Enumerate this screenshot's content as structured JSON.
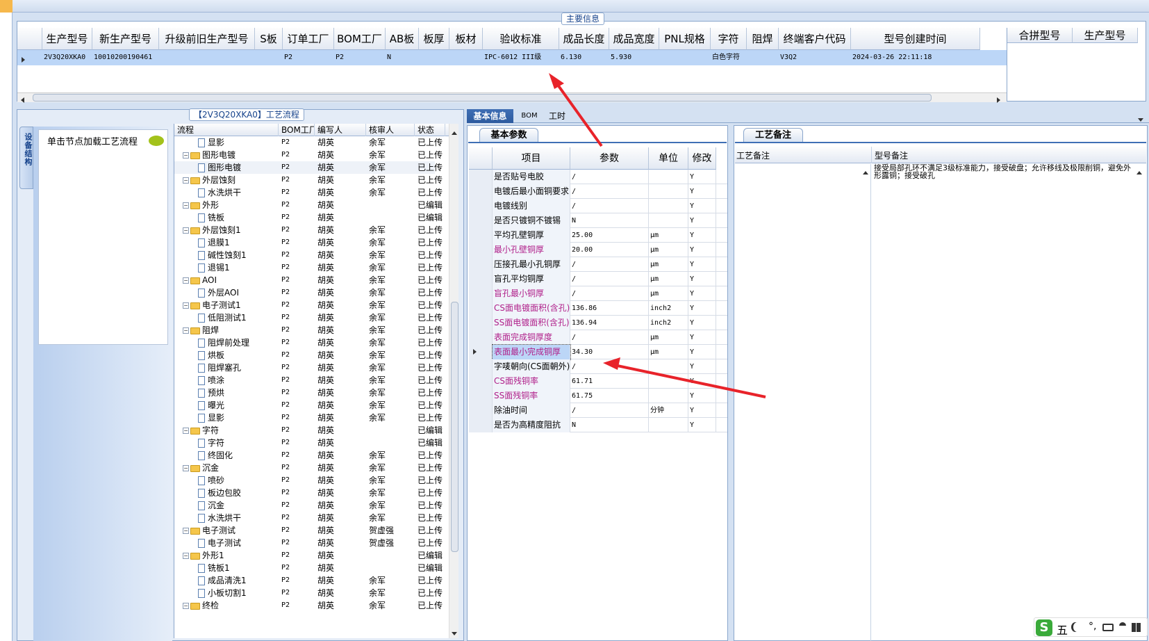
{
  "main_info": {
    "title": "主要信息",
    "columns": [
      "生产型号",
      "新生产型号",
      "升级前旧生产型号",
      "S板",
      "订单工厂",
      "BOM工厂",
      "AB板",
      "板厚",
      "板材",
      "验收标准",
      "成品长度",
      "成品宽度",
      "PNL规格",
      "字符",
      "阻焊",
      "终端客户代码",
      "型号创建时间"
    ],
    "row": [
      "2V3Q20XKA0",
      "10010200190461",
      "",
      "",
      "P2",
      "P2",
      "N",
      "",
      "",
      "IPC-6012 III级",
      "6.130",
      "5.930",
      "",
      "白色字符",
      "",
      "V3Q2",
      "2024-03-26 22:11:18"
    ],
    "side_columns": [
      "合拼型号",
      "生产型号"
    ]
  },
  "process": {
    "title": "【2V3Q20XKA0】工艺流程",
    "vertical_tab": "设备结构",
    "load_button": "单击节点加载工艺流程",
    "columns": [
      "流程",
      "BOM工厂",
      "编写人",
      "核审人",
      "状态"
    ],
    "rows": [
      {
        "level": 2,
        "name": "显影",
        "bom": "P2",
        "writer": "胡英",
        "checker": "余军",
        "status": "已上传"
      },
      {
        "level": 1,
        "name": "图形电镀",
        "bom": "P2",
        "writer": "胡英",
        "checker": "余军",
        "status": "已上传"
      },
      {
        "level": 2,
        "name": "图形电镀",
        "bom": "P2",
        "writer": "胡英",
        "checker": "余军",
        "status": "已上传"
      },
      {
        "level": 1,
        "name": "外层蚀刻",
        "bom": "P2",
        "writer": "胡英",
        "checker": "余军",
        "status": "已上传"
      },
      {
        "level": 2,
        "name": "水洗烘干",
        "bom": "P2",
        "writer": "胡英",
        "checker": "余军",
        "status": "已上传"
      },
      {
        "level": 1,
        "name": "外形",
        "bom": "P2",
        "writer": "胡英",
        "checker": "",
        "status": "已编辑"
      },
      {
        "level": 2,
        "name": "铣板",
        "bom": "P2",
        "writer": "胡英",
        "checker": "",
        "status": "已编辑"
      },
      {
        "level": 1,
        "name": "外层蚀刻1",
        "bom": "P2",
        "writer": "胡英",
        "checker": "余军",
        "status": "已上传"
      },
      {
        "level": 2,
        "name": "退膜1",
        "bom": "P2",
        "writer": "胡英",
        "checker": "余军",
        "status": "已上传"
      },
      {
        "level": 2,
        "name": "碱性蚀刻1",
        "bom": "P2",
        "writer": "胡英",
        "checker": "余军",
        "status": "已上传"
      },
      {
        "level": 2,
        "name": "退锡1",
        "bom": "P2",
        "writer": "胡英",
        "checker": "余军",
        "status": "已上传"
      },
      {
        "level": 1,
        "name": "AOI",
        "bom": "P2",
        "writer": "胡英",
        "checker": "余军",
        "status": "已上传"
      },
      {
        "level": 2,
        "name": "外层AOI",
        "bom": "P2",
        "writer": "胡英",
        "checker": "余军",
        "status": "已上传"
      },
      {
        "level": 1,
        "name": "电子测试1",
        "bom": "P2",
        "writer": "胡英",
        "checker": "余军",
        "status": "已上传"
      },
      {
        "level": 2,
        "name": "低阻测试1",
        "bom": "P2",
        "writer": "胡英",
        "checker": "余军",
        "status": "已上传"
      },
      {
        "level": 1,
        "name": "阻焊",
        "bom": "P2",
        "writer": "胡英",
        "checker": "余军",
        "status": "已上传"
      },
      {
        "level": 2,
        "name": "阻焊前处理",
        "bom": "P2",
        "writer": "胡英",
        "checker": "余军",
        "status": "已上传"
      },
      {
        "level": 2,
        "name": "烘板",
        "bom": "P2",
        "writer": "胡英",
        "checker": "余军",
        "status": "已上传"
      },
      {
        "level": 2,
        "name": "阻焊塞孔",
        "bom": "P2",
        "writer": "胡英",
        "checker": "余军",
        "status": "已上传"
      },
      {
        "level": 2,
        "name": "喷涂",
        "bom": "P2",
        "writer": "胡英",
        "checker": "余军",
        "status": "已上传"
      },
      {
        "level": 2,
        "name": "预烘",
        "bom": "P2",
        "writer": "胡英",
        "checker": "余军",
        "status": "已上传"
      },
      {
        "level": 2,
        "name": "曝光",
        "bom": "P2",
        "writer": "胡英",
        "checker": "余军",
        "status": "已上传"
      },
      {
        "level": 2,
        "name": "显影",
        "bom": "P2",
        "writer": "胡英",
        "checker": "余军",
        "status": "已上传"
      },
      {
        "level": 1,
        "name": "字符",
        "bom": "P2",
        "writer": "胡英",
        "checker": "",
        "status": "已编辑"
      },
      {
        "level": 2,
        "name": "字符",
        "bom": "P2",
        "writer": "胡英",
        "checker": "",
        "status": "已编辑"
      },
      {
        "level": 2,
        "name": "终固化",
        "bom": "P2",
        "writer": "胡英",
        "checker": "余军",
        "status": "已上传"
      },
      {
        "level": 1,
        "name": "沉金",
        "bom": "P2",
        "writer": "胡英",
        "checker": "余军",
        "status": "已上传"
      },
      {
        "level": 2,
        "name": "喷砂",
        "bom": "P2",
        "writer": "胡英",
        "checker": "余军",
        "status": "已上传"
      },
      {
        "level": 2,
        "name": "板边包胶",
        "bom": "P2",
        "writer": "胡英",
        "checker": "余军",
        "status": "已上传"
      },
      {
        "level": 2,
        "name": "沉金",
        "bom": "P2",
        "writer": "胡英",
        "checker": "余军",
        "status": "已上传"
      },
      {
        "level": 2,
        "name": "水洗烘干",
        "bom": "P2",
        "writer": "胡英",
        "checker": "余军",
        "status": "已上传"
      },
      {
        "level": 1,
        "name": "电子测试",
        "bom": "P2",
        "writer": "胡英",
        "checker": "贺虚强",
        "status": "已上传"
      },
      {
        "level": 2,
        "name": "电子测试",
        "bom": "P2",
        "writer": "胡英",
        "checker": "贺虚强",
        "status": "已上传"
      },
      {
        "level": 1,
        "name": "外形1",
        "bom": "P2",
        "writer": "胡英",
        "checker": "",
        "status": "已编辑"
      },
      {
        "level": 2,
        "name": "铣板1",
        "bom": "P2",
        "writer": "胡英",
        "checker": "",
        "status": "已编辑"
      },
      {
        "level": 2,
        "name": "成品清洗1",
        "bom": "P2",
        "writer": "胡英",
        "checker": "余军",
        "status": "已上传"
      },
      {
        "level": 2,
        "name": "小板切割1",
        "bom": "P2",
        "writer": "胡英",
        "checker": "余军",
        "status": "已上传"
      },
      {
        "level": 1,
        "name": "终检",
        "bom": "P2",
        "writer": "胡英",
        "checker": "余军",
        "status": "已上传"
      }
    ]
  },
  "tabs": [
    "基本信息",
    "BOM",
    "工时"
  ],
  "params": {
    "subtab": "基本参数",
    "columns": [
      "项目",
      "参数",
      "单位",
      "修改"
    ],
    "rows": [
      {
        "item": "是否贴号电胶",
        "value": "/",
        "unit": "",
        "mod": "Y",
        "color": "#000000"
      },
      {
        "item": "电镀后最小面铜要求",
        "value": "/",
        "unit": "",
        "mod": "Y",
        "color": "#000000"
      },
      {
        "item": "电镀线别",
        "value": "/",
        "unit": "",
        "mod": "Y",
        "color": "#000000"
      },
      {
        "item": "是否只镀铜不镀锡",
        "value": "N",
        "unit": "",
        "mod": "Y",
        "color": "#000000"
      },
      {
        "item": "平均孔壁铜厚",
        "value": "25.00",
        "unit": "μm",
        "mod": "Y",
        "color": "#000000"
      },
      {
        "item": "最小孔壁铜厚",
        "value": "20.00",
        "unit": "μm",
        "mod": "Y",
        "color": "#b0208a"
      },
      {
        "item": "压接孔最小孔铜厚",
        "value": "/",
        "unit": "μm",
        "mod": "Y",
        "color": "#000000"
      },
      {
        "item": "盲孔平均铜厚",
        "value": "/",
        "unit": "μm",
        "mod": "Y",
        "color": "#000000"
      },
      {
        "item": "盲孔最小铜厚",
        "value": "/",
        "unit": "μm",
        "mod": "Y",
        "color": "#b0208a"
      },
      {
        "item": "CS面电镀面积(含孔)",
        "value": "136.86",
        "unit": "inch2",
        "mod": "Y",
        "color": "#b0208a"
      },
      {
        "item": "SS面电镀面积(含孔)",
        "value": "136.94",
        "unit": "inch2",
        "mod": "Y",
        "color": "#b0208a"
      },
      {
        "item": "表面完成铜厚度",
        "value": "/",
        "unit": "μm",
        "mod": "Y",
        "color": "#b0208a"
      },
      {
        "item": "表面最小完成铜厚",
        "value": "34.30",
        "unit": "μm",
        "mod": "Y",
        "color": "#b0208a"
      },
      {
        "item": "字唛朝向(CS面朝外)",
        "value": "/",
        "unit": "",
        "mod": "Y",
        "color": "#000000"
      },
      {
        "item": "CS面残铜率",
        "value": "61.71",
        "unit": "",
        "mod": "Y",
        "color": "#b0208a"
      },
      {
        "item": "SS面残铜率",
        "value": "61.75",
        "unit": "",
        "mod": "Y",
        "color": "#b0208a"
      },
      {
        "item": "除油时间",
        "value": "/",
        "unit": "分钟",
        "mod": "Y",
        "color": "#000000"
      },
      {
        "item": "是否为高精度阻抗",
        "value": "N",
        "unit": "",
        "mod": "Y",
        "color": "#000000"
      }
    ]
  },
  "remarks": {
    "subtab": "工艺备注",
    "col1": "工艺备注",
    "col2": "型号备注",
    "model_remark": "接受局部孔环不满足3级标准能力，接受破盘；允许移线及极限削铜，避免外形露铜；接受破孔"
  },
  "ime": {
    "label": "五"
  },
  "colors": {
    "accent": "#2d5a9e",
    "arrow": "#e8232a",
    "selected": "#bcd6f7",
    "magenta": "#b0208a"
  }
}
